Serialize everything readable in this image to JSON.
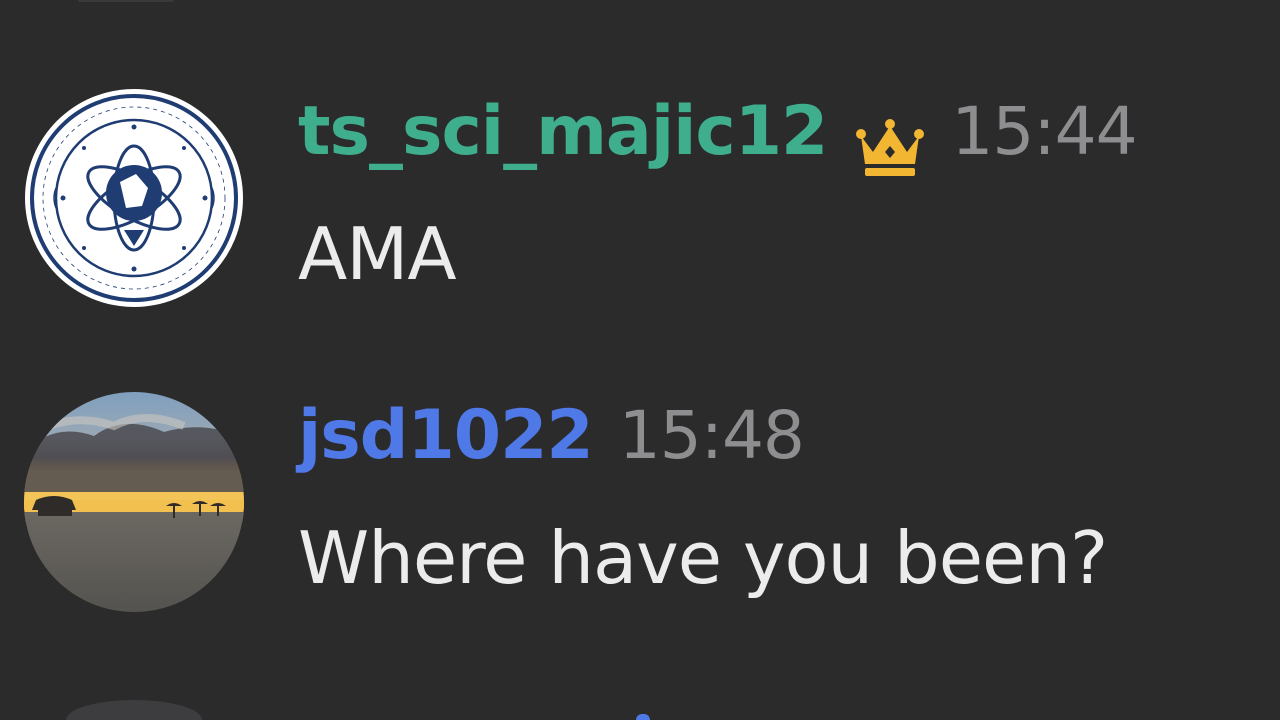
{
  "theme": {
    "background": "#2b2b2c",
    "accent_green": "#3fae8c",
    "accent_blue": "#4f79e6",
    "timestamp": "#8e8e90",
    "message_text": "#ececec",
    "crown": "#f2b632"
  },
  "messages": [
    {
      "username": "ts_sci_majic12",
      "badge_icon": "crown-icon",
      "time": "15:44",
      "text": "AMA",
      "avatar": "defense-intelligence-agency-seal"
    },
    {
      "username": "jsd1022",
      "time": "15:48",
      "text": "Where have you been?",
      "avatar": "beach-sunset-photo"
    }
  ]
}
